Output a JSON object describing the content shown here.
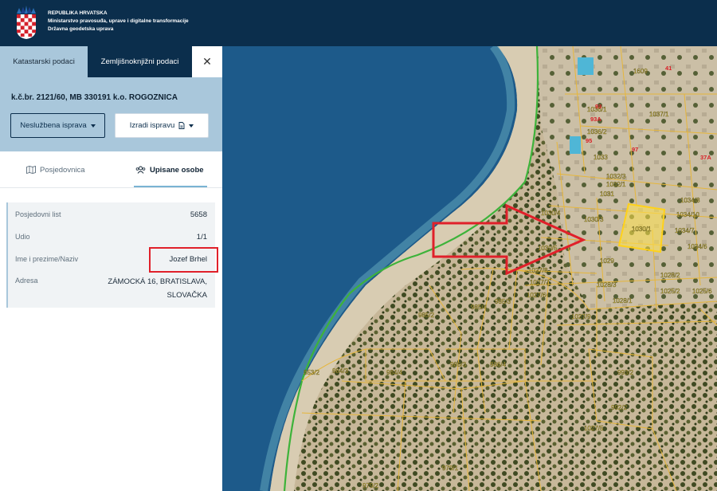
{
  "header": {
    "line1": "REPUBLIKA HRVATSKA",
    "line2": "Ministarstvo pravosuđa, uprave i digitalne transformacije",
    "line3": "Državna geodetska uprava"
  },
  "sidebar": {
    "tabs": [
      "Katastarski podaci",
      "Zemljišnoknjižni podaci"
    ],
    "close_glyph": "✕",
    "parcel_title": "k.č.br. 2121/60, MB 330191 k.o. ROGOZNICA",
    "button_unofficial": "Neslužbena isprava",
    "button_make": "Izradi ispravu",
    "subtabs": [
      "Posjedovnica",
      "Upisane osobe"
    ],
    "info": {
      "posjedovni_list_label": "Posjedovni list",
      "posjedovni_list_value": "5658",
      "udio_label": "Udio",
      "udio_value": "1/1",
      "ime_label": "Ime i prezime/Naziv",
      "ime_value": "Jozef Brhel",
      "adresa_label": "Adresa",
      "adresa_line1": "ZÁMOCKÁ 16, BRATISLAVA,",
      "adresa_line2": "SLOVAČKA"
    }
  },
  "map": {
    "parcel_labels": [
      "1030/4",
      "1030/3",
      "1030/1",
      "1031",
      "1032/3",
      "1032/1",
      "1033",
      "1034/8",
      "1034/10",
      "1034/7",
      "1034/6",
      "1030/5",
      "1029",
      "1027/8",
      "1027/7",
      "1027/6",
      "1027/9",
      "1028/3",
      "1028/1",
      "1028/2",
      "1025/2",
      "1025/6",
      "985/2",
      "985/4",
      "985/3",
      "986/3",
      "986/4",
      "984/3",
      "984/4",
      "853/2",
      "993/2",
      "992/2",
      "1027/5",
      "979/1",
      "979/2",
      "1037/1",
      "1036/1",
      "1036/2",
      "1609"
    ],
    "house_labels": [
      "93",
      "93A",
      "95",
      "97",
      "41",
      "37A"
    ]
  },
  "colors": {
    "header_bg": "#0b2e4c",
    "tab_active_bg": "#a9c7db",
    "sea": "#1d5a8a",
    "parcel_line": "#e6b63a",
    "shore_line": "#3db33a",
    "arrow_red": "#e0202a",
    "selected_parcel": "#ffe14a"
  }
}
